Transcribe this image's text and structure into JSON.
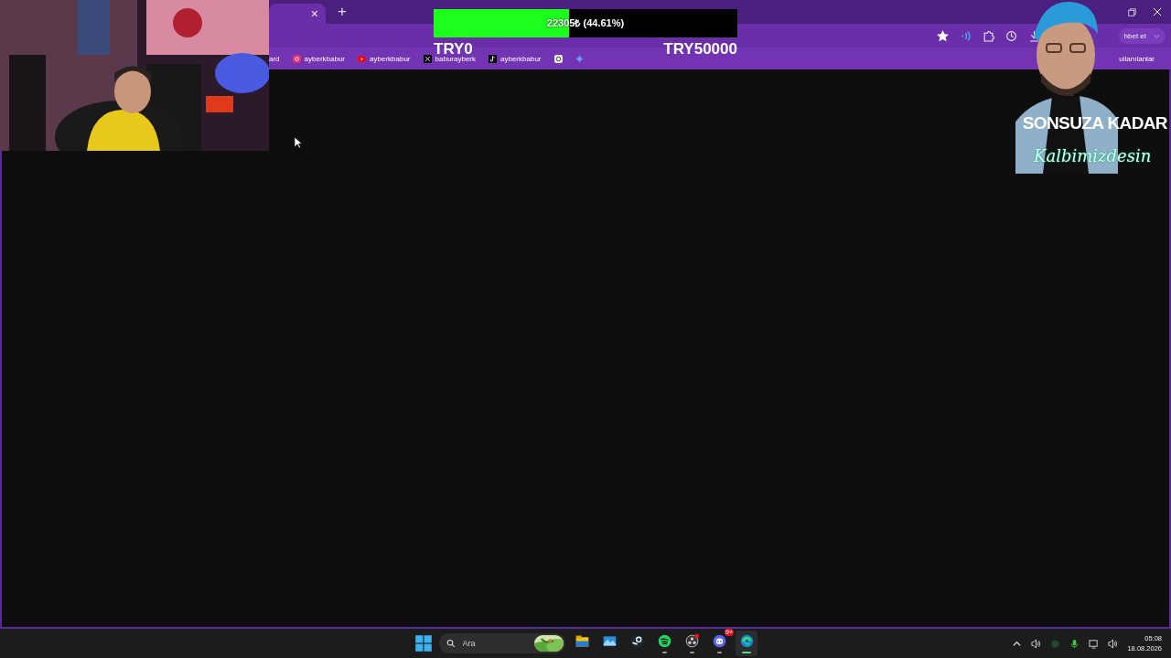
{
  "browser": {
    "tab_close": "×",
    "new_tab": "+",
    "profile_label": "hbet et",
    "bookmarks": [
      {
        "kind": "plain",
        "label": "ard"
      },
      {
        "kind": "instagram",
        "label": "ayberkbabur"
      },
      {
        "kind": "youtube",
        "label": "ayberkbabur"
      },
      {
        "kind": "x",
        "label": "baburayberk"
      },
      {
        "kind": "tiktok",
        "label": "ayberkbabur"
      },
      {
        "kind": "threads"
      },
      {
        "kind": "sparkle"
      }
    ],
    "other_bookmarks": "ullanılanlar"
  },
  "donation_goal": {
    "amount": "22305₺ (44.61%)",
    "level": 0.4461,
    "min_label": "TRY0",
    "max_label": "TRY50000"
  },
  "streamer_overlay": {
    "title": "SONSUZA KADAR",
    "subtitle": "Kalbimizdesin"
  },
  "taskbar": {
    "search": {
      "placeholder": "Ara"
    },
    "apps": [
      {
        "kind": "files",
        "running": false,
        "selected": false
      },
      {
        "kind": "photos",
        "running": false,
        "selected": false
      },
      {
        "kind": "steam",
        "running": false,
        "selected": false
      },
      {
        "kind": "spotify",
        "running": true,
        "selected": false
      },
      {
        "kind": "obs",
        "running": true,
        "selected": false
      },
      {
        "kind": "discord",
        "running": true,
        "selected": false,
        "badge": "9+"
      },
      {
        "kind": "edge",
        "running": true,
        "selected": true
      }
    ],
    "clock": {
      "time": "05:08",
      "date": "18.08.2026"
    }
  }
}
